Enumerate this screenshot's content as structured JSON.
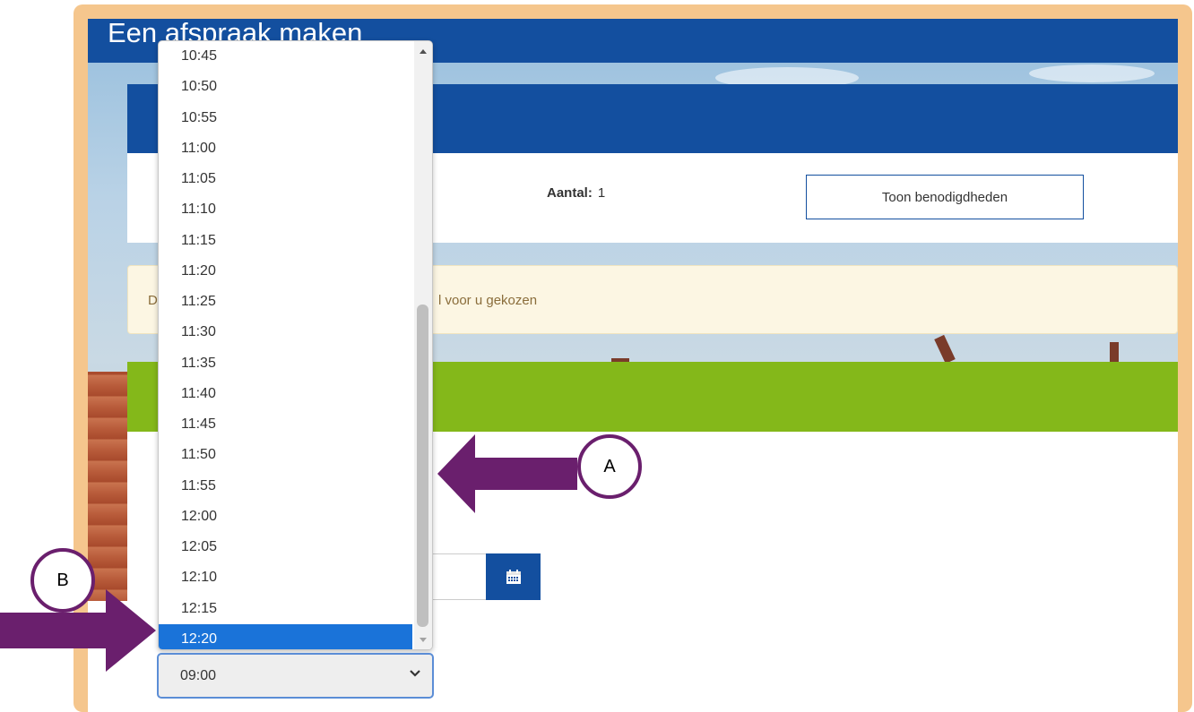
{
  "header": {
    "title": "Een afspraak maken"
  },
  "summary": {
    "count_label": "Aantal:",
    "count_value": "1",
    "show_items_button": "Toon benodigdheden"
  },
  "notice": {
    "lead_text": "D",
    "tail_text": "l voor u gekozen"
  },
  "time_dropdown": {
    "options": [
      "10:45",
      "10:50",
      "10:55",
      "11:00",
      "11:05",
      "11:10",
      "11:15",
      "11:20",
      "11:25",
      "11:30",
      "11:35",
      "11:40",
      "11:45",
      "11:50",
      "11:55",
      "12:00",
      "12:05",
      "12:10",
      "12:15",
      "12:20"
    ],
    "highlighted": "12:20",
    "selected_value": "09:00"
  },
  "annotations": {
    "a_label": "A",
    "b_label": "B",
    "arrow_color": "#6a1f6d"
  },
  "colors": {
    "brand_blue": "#134f9f",
    "green": "#84b81a",
    "highlight": "#1a73d9",
    "frame": "#f5c68d"
  }
}
